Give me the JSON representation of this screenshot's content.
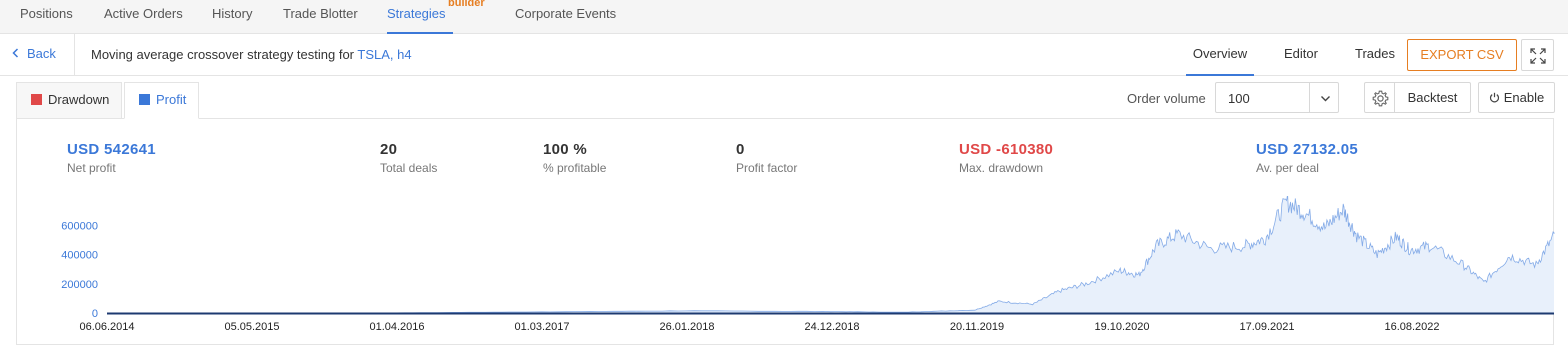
{
  "nav": {
    "items": [
      "Positions",
      "Active Orders",
      "History",
      "Trade Blotter",
      "Strategies",
      "Corporate Events"
    ],
    "strategies_badge": "builder",
    "active": "Strategies"
  },
  "header": {
    "back_label": "Back",
    "title_prefix": "Moving average crossover strategy testing for",
    "title_symbol": "TSLA, h4",
    "tabs": [
      "Overview",
      "Editor",
      "Trades"
    ],
    "active_tab": "Overview",
    "export_label": "EXPORT CSV"
  },
  "tabs": {
    "drawdown_label": "Drawdown",
    "profit_label": "Profit",
    "drawdown_color": "#e04848",
    "profit_color": "#3b78d8"
  },
  "controls": {
    "order_volume_label": "Order volume",
    "order_volume_value": "100",
    "backtest_label": "Backtest",
    "enable_label": "Enable"
  },
  "stats": {
    "net_profit": {
      "value": "USD 542641",
      "label": "Net profit"
    },
    "total_deals": {
      "value": "20",
      "label": "Total deals"
    },
    "profitable": {
      "value": "100 %",
      "label": "% profitable"
    },
    "profit_factor": {
      "value": "0",
      "label": "Profit factor"
    },
    "max_drawdown": {
      "value": "USD -610380",
      "label": "Max. drawdown"
    },
    "avg_per_deal": {
      "value": "USD 27132.05",
      "label": "Av. per deal"
    }
  },
  "chart_data": {
    "type": "area",
    "title": "",
    "xlabel": "",
    "ylabel": "",
    "ylim": [
      0,
      800000
    ],
    "y_ticks": [
      "600000",
      "400000",
      "200000",
      "0"
    ],
    "x_ticks": [
      "06.06.2014",
      "05.05.2015",
      "01.04.2016",
      "01.03.2017",
      "26.01.2018",
      "24.12.2018",
      "20.11.2019",
      "19.10.2020",
      "17.09.2021",
      "16.08.2022"
    ],
    "grid": false,
    "series": [
      {
        "color": "#3b78d8",
        "fill": "#e8f0fb",
        "x": [
          "2014-06-06",
          "2015-05-05",
          "2016-04-01",
          "2017-03-01",
          "2018-01-26",
          "2018-12-24",
          "2019-06-01",
          "2019-11-20",
          "2020-01-15",
          "2020-04-01",
          "2020-06-01",
          "2020-08-01",
          "2020-10-19",
          "2020-12-01",
          "2021-01-10",
          "2021-03-01",
          "2021-05-15",
          "2021-08-01",
          "2021-09-17",
          "2021-11-05",
          "2021-12-15",
          "2022-02-01",
          "2022-03-15",
          "2022-04-15",
          "2022-06-01",
          "2022-07-15",
          "2022-08-16",
          "2022-10-01",
          "2022-12-15",
          "2023-02-01",
          "2023-04-01",
          "2023-06-01",
          "2023-07-15"
        ],
        "values": [
          0,
          0,
          1000,
          8000,
          15000,
          10000,
          5000,
          20000,
          80000,
          60000,
          150000,
          200000,
          290000,
          260000,
          460000,
          540000,
          440000,
          460000,
          510000,
          760000,
          690000,
          580000,
          710000,
          530000,
          400000,
          520000,
          430000,
          460000,
          330000,
          210000,
          390000,
          330000,
          540000
        ]
      }
    ]
  }
}
